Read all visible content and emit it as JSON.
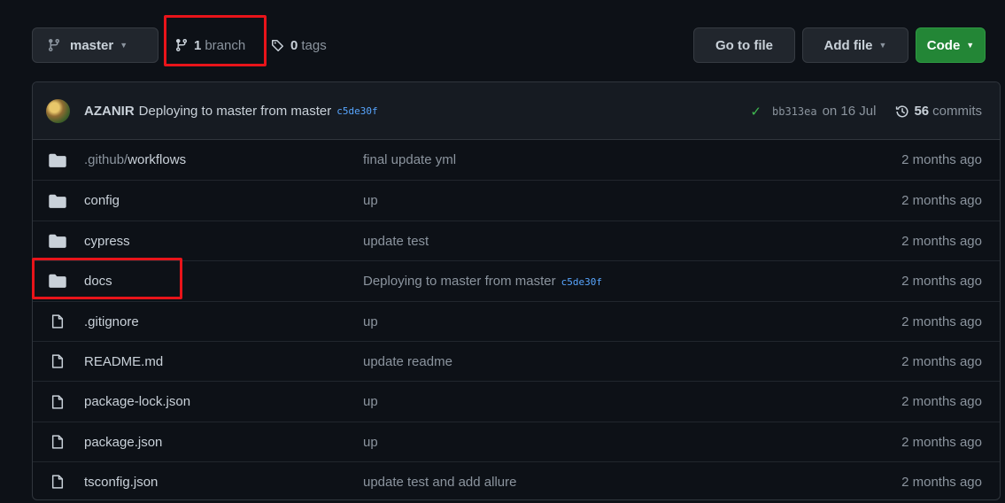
{
  "toolbar": {
    "branch_name": "master",
    "branch_count": "1",
    "branch_label": "branch",
    "tag_count": "0",
    "tag_label": "tags",
    "goto_file": "Go to file",
    "add_file": "Add file",
    "code": "Code"
  },
  "latest_commit": {
    "author": "AZANIR",
    "message": "Deploying to master from master",
    "sha_link": "c5de30f",
    "status": "success",
    "sha": "bb313ea",
    "date": "on 16 Jul",
    "commit_count": "56",
    "commit_label": "commits"
  },
  "files": [
    {
      "type": "folder",
      "name_prefix": ".github/",
      "name": "workflows",
      "message": "final update yml",
      "sha": "",
      "age": "2 months ago"
    },
    {
      "type": "folder",
      "name_prefix": "",
      "name": "config",
      "message": "up",
      "sha": "",
      "age": "2 months ago"
    },
    {
      "type": "folder",
      "name_prefix": "",
      "name": "cypress",
      "message": "update test",
      "sha": "",
      "age": "2 months ago"
    },
    {
      "type": "folder",
      "name_prefix": "",
      "name": "docs",
      "message": "Deploying to master from master",
      "sha": "c5de30f",
      "age": "2 months ago"
    },
    {
      "type": "file",
      "name_prefix": "",
      "name": ".gitignore",
      "message": "up",
      "sha": "",
      "age": "2 months ago"
    },
    {
      "type": "file",
      "name_prefix": "",
      "name": "README.md",
      "message": "update readme",
      "sha": "",
      "age": "2 months ago"
    },
    {
      "type": "file",
      "name_prefix": "",
      "name": "package-lock.json",
      "message": "up",
      "sha": "",
      "age": "2 months ago"
    },
    {
      "type": "file",
      "name_prefix": "",
      "name": "package.json",
      "message": "up",
      "sha": "",
      "age": "2 months ago"
    },
    {
      "type": "file",
      "name_prefix": "",
      "name": "tsconfig.json",
      "message": "update test and add allure",
      "sha": "",
      "age": "2 months ago"
    }
  ],
  "colors": {
    "background": "#0d1117",
    "accent_green": "#238636",
    "link_blue": "#58a6ff",
    "highlight_red": "#e8141a"
  }
}
